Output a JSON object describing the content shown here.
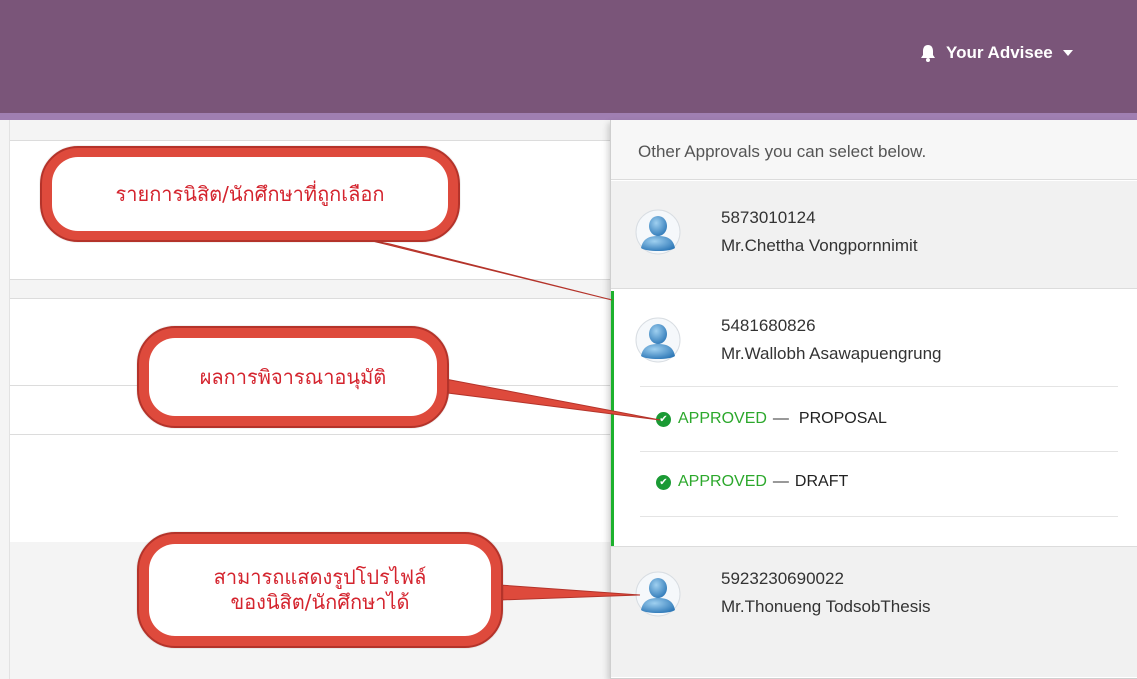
{
  "header": {
    "menu_label": "Your Advisee",
    "bg_color": "#7a5579",
    "bell_icon": "bell-icon"
  },
  "dropdown": {
    "header_text": "Other Approvals you can select below.",
    "items": [
      {
        "id": "5873010124",
        "name": "Mr.Chettha Vongpornnimit",
        "selected": false
      },
      {
        "id": "5481680826",
        "name": "Mr.Wallobh Asawapuengrung",
        "selected": true,
        "statuses": [
          {
            "state": "APPROVED",
            "separator": "—",
            "type": "PROPOSAL"
          },
          {
            "state": "APPROVED",
            "separator": "—",
            "type": "DRAFT"
          }
        ]
      },
      {
        "id": "5923230690022",
        "name": "Mr.Thonueng TodsobThesis",
        "selected": false
      }
    ],
    "accent_color": "#1db12d"
  },
  "annotations": {
    "selected_list": "รายการนิสิต/นักศึกษาที่ถูกเลือก",
    "approval_result": "ผลการพิจารณาอนุมัติ",
    "profile_line1": "สามารถแสดงรูปโปรไฟล์",
    "profile_line2": "ของนิสิต/นักศึกษาได้",
    "color": "#de4a3c"
  }
}
